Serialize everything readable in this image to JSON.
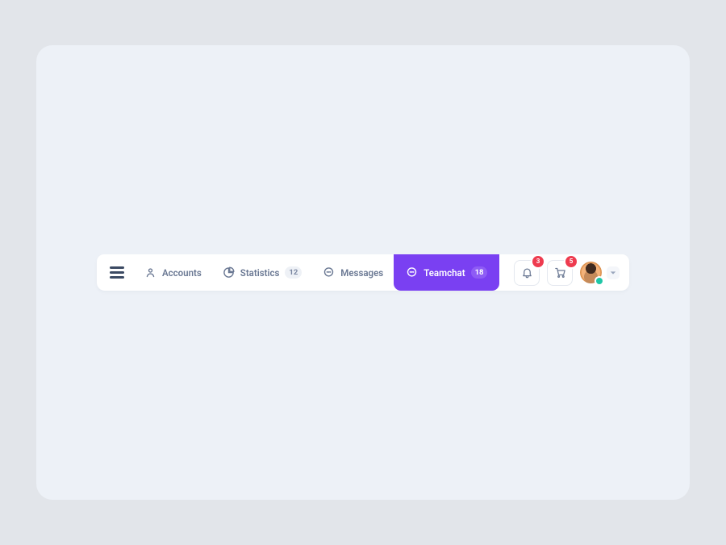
{
  "colors": {
    "accent": "#7a40f2",
    "danger": "#ee3b4f",
    "presence_online": "#1fc6a6"
  },
  "nav": {
    "items": [
      {
        "id": "accounts",
        "icon": "user-icon",
        "label": "Accounts",
        "active": false
      },
      {
        "id": "statistics",
        "icon": "pie-chart-icon",
        "label": "Statistics",
        "badge": "12",
        "active": false
      },
      {
        "id": "messages",
        "icon": "chat-icon",
        "label": "Messages",
        "active": false
      },
      {
        "id": "teamchat",
        "icon": "chat-icon",
        "label": "Teamchat",
        "badge": "18",
        "active": true
      }
    ]
  },
  "actions": {
    "notifications": {
      "icon": "bell-icon",
      "badge": "3"
    },
    "cart": {
      "icon": "cart-icon",
      "badge": "5"
    }
  },
  "user": {
    "presence": "online",
    "menu_icon": "chevron-down-icon"
  }
}
